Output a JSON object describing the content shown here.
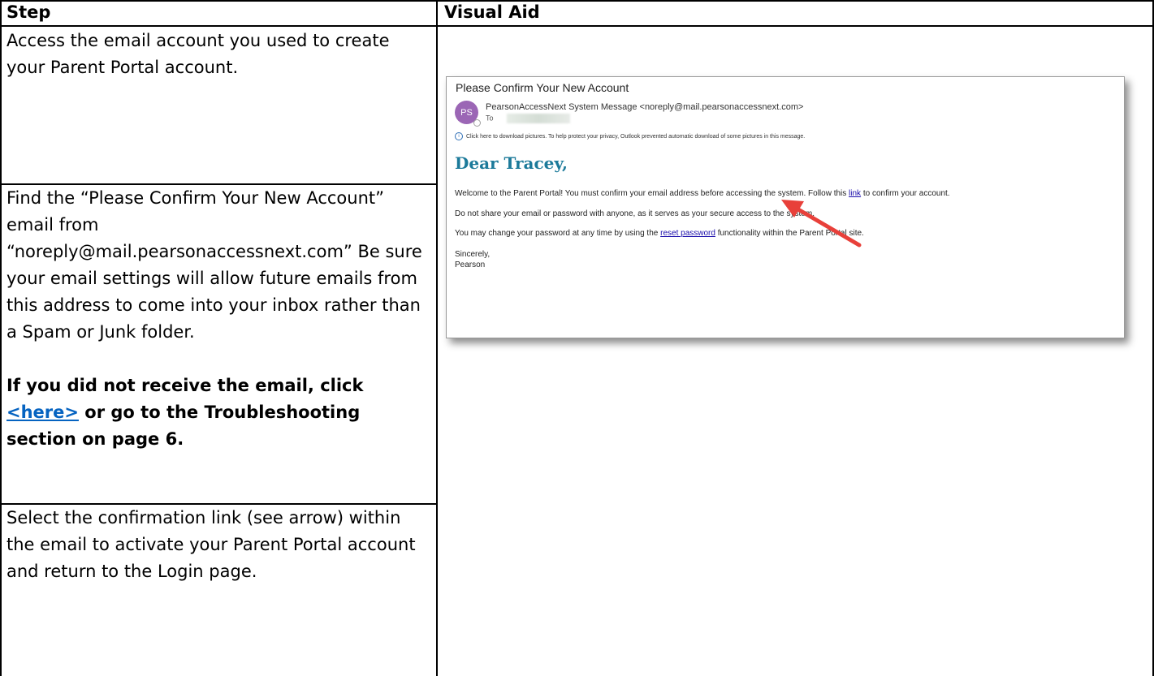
{
  "table": {
    "header": {
      "step": "Step",
      "visual_aid": "Visual Aid"
    },
    "rows": [
      {
        "text": "Access the email account you used to create your Parent Portal account."
      },
      {
        "text": "Find the “Please Confirm Your New Account” email from “noreply@mail.pearsonaccessnext.com” Be sure your email settings will allow future emails from this address to come into your inbox rather than a Spam or Junk folder.",
        "bold_prefix": "If you did not receive the email, click",
        "link": "<here>",
        "bold_suffix": "or go to the Troubleshooting section on page 6."
      },
      {
        "text": "Select the confirmation link (see arrow) within the email to activate your Parent Portal account and return to the Login page."
      }
    ]
  },
  "email": {
    "subject": "Please Confirm Your New Account",
    "avatar_initials": "PS",
    "avatar_color": "#9b66b5",
    "sender": "PearsonAccessNext System Message <noreply@mail.pearsonaccessnext.com>",
    "to_label": "To",
    "info_notice": "Click here to download pictures. To help protect your privacy, Outlook prevented automatic download of some pictures in this message.",
    "greeting": "Dear Tracey,",
    "line1_before": "Welcome to the Parent Portal! You must confirm your email address before accessing the system. Follow this",
    "line1_link": "link",
    "line1_after": "to confirm your account.",
    "line2": "Do not share your email or password with anyone, as it serves as your secure access to the system.",
    "line3_before": "You may change your password at any time by using the",
    "line3_link": "reset password",
    "line3_after": "functionality within the Parent Portal site.",
    "signoff": "Sincerely,",
    "signature": "Pearson"
  },
  "colors": {
    "link": "#0563c1",
    "greeting": "#1c7a9a",
    "arrow": "#e8403a"
  }
}
